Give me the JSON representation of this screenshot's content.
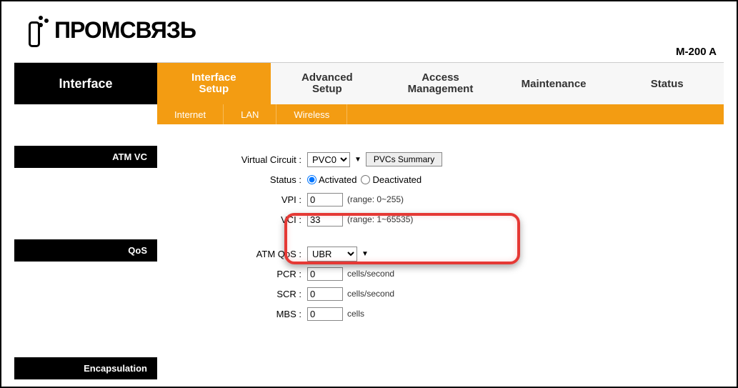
{
  "header": {
    "brand": "ПРОМСВЯЗЬ",
    "model": "M-200 A"
  },
  "page_title": "Interface",
  "main_tabs": [
    {
      "label": "Interface Setup",
      "active": true
    },
    {
      "label": "Advanced Setup",
      "active": false
    },
    {
      "label": "Access Management",
      "active": false
    },
    {
      "label": "Maintenance",
      "active": false
    },
    {
      "label": "Status",
      "active": false
    }
  ],
  "sub_tabs": [
    {
      "label": "Internet"
    },
    {
      "label": "LAN"
    },
    {
      "label": "Wireless"
    }
  ],
  "side_sections": [
    "ATM VC",
    "QoS",
    "Encapsulation"
  ],
  "atm": {
    "vc_label": "Virtual Circuit :",
    "vc_value": "PVC0",
    "summary_btn": "PVCs Summary",
    "status_label": "Status :",
    "status_activated": "Activated",
    "status_deactivated": "Deactivated",
    "vpi_label": "VPI :",
    "vpi_value": "0",
    "vpi_hint": "(range: 0~255)",
    "vci_label": "VCI :",
    "vci_value": "33",
    "vci_hint": "(range: 1~65535)"
  },
  "qos": {
    "atmqos_label": "ATM QoS :",
    "atmqos_value": "UBR",
    "pcr_label": "PCR :",
    "pcr_value": "0",
    "pcr_unit": "cells/second",
    "scr_label": "SCR :",
    "scr_value": "0",
    "scr_unit": "cells/second",
    "mbs_label": "MBS :",
    "mbs_value": "0",
    "mbs_unit": "cells"
  }
}
